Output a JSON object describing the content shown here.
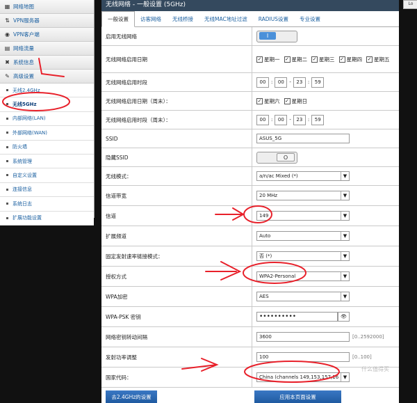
{
  "top_right_button": "Lo",
  "sidebar": {
    "items": [
      {
        "label": "网络地图",
        "icon": "network-map-icon",
        "glyph": "▦"
      },
      {
        "label": "VPN服务器",
        "icon": "vpn-server-icon",
        "glyph": "⇅"
      },
      {
        "label": "VPN客户端",
        "icon": "vpn-client-icon",
        "glyph": "◉"
      },
      {
        "label": "网络流量",
        "icon": "traffic-icon",
        "glyph": "▤"
      },
      {
        "label": "系统信息",
        "icon": "system-info-icon",
        "glyph": "✖"
      },
      {
        "label": "高级设置",
        "icon": "wrench-icon",
        "glyph": "✎"
      }
    ],
    "subitems": [
      "无线2.4GHz",
      "无线5GHz",
      "内部网络(LAN)",
      "外部网络(WAN)",
      "防火墙",
      "系统管理",
      "自定义设置",
      "连接信息",
      "系统日志",
      "扩展功能设置"
    ]
  },
  "main": {
    "title": "无线网络 - 一般设置 (5GHz)",
    "tabs": [
      "一般设置",
      "访客网络",
      "无线桥接",
      "无线MAC地址过滤",
      "RADIUS设置",
      "专业设置"
    ],
    "rows": {
      "enable_wireless": {
        "label": "启用无线网络",
        "toggle": "I"
      },
      "enable_days": {
        "label": "无线网络启用日期",
        "days": [
          "星期一",
          "星期二",
          "星期三",
          "星期四",
          "星期五"
        ]
      },
      "enable_time": {
        "label": "无线网络启用时段",
        "start_h": "00",
        "start_m": "00",
        "end_h": "23",
        "end_m": "59"
      },
      "weekend_days": {
        "label": "无线网络启用日期（周末）：",
        "days": [
          "星期六",
          "星期日"
        ]
      },
      "weekend_time": {
        "label": "无线网络启用时段（周末）：",
        "start_h": "00",
        "start_m": "00",
        "end_h": "23",
        "end_m": "59"
      },
      "ssid": {
        "label": "SSID",
        "value": "ASUS_5G"
      },
      "hide_ssid": {
        "label": "隐藏SSID",
        "toggle": "O"
      },
      "mode": {
        "label": "无线模式：",
        "value": "a/n/ac Mixed (*)"
      },
      "bandwidth": {
        "label": "信道带宽",
        "value": "20 MHz"
      },
      "channel": {
        "label": "信道",
        "value": "149"
      },
      "ext_channel": {
        "label": "扩展频道",
        "value": "Auto"
      },
      "fixed_rate": {
        "label": "固定发射速率链接模式：",
        "value": "否 (*)"
      },
      "auth": {
        "label": "授权方式",
        "value": "WPA2-Personal"
      },
      "wpa_enc": {
        "label": "WPA加密",
        "value": "AES"
      },
      "psk": {
        "label": "WPA-PSK 密钥",
        "value": "••••••••••"
      },
      "key_interval": {
        "label": "网络密钥转动间隔",
        "value": "3600",
        "hint": "[0..2592000]"
      },
      "tx_power": {
        "label": "发射功率调整",
        "value": "100",
        "hint": "[0..100]"
      },
      "country": {
        "label": "国家代码：",
        "value": "China (channels 149,153,157,16"
      }
    },
    "buttons": {
      "left": "去2.4GHz的设置",
      "apply": "应用本页面设置"
    }
  },
  "watermark": "什么值得买",
  "annotation_color": "#e8202a"
}
